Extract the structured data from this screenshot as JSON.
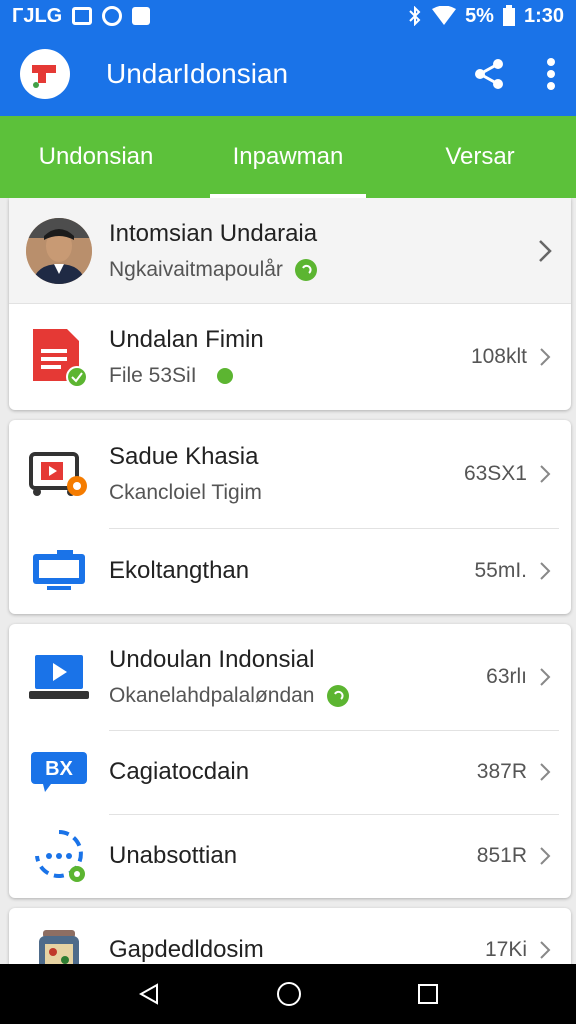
{
  "status": {
    "carrier": "ГJLG",
    "battery": "5%",
    "time": "1:30"
  },
  "app": {
    "title": "UndarIdonsian"
  },
  "tabs": [
    {
      "label": "Undonsian",
      "active": false
    },
    {
      "label": "Inpawman",
      "active": true
    },
    {
      "label": "Versar",
      "active": false
    }
  ],
  "profile": {
    "name": "Intomsian Undaraia",
    "subtitle": "Ngkaivaitmapoulår"
  },
  "cards": [
    {
      "items": [
        {
          "title": "Undalan Fimin",
          "subtitle": "File 53SiI",
          "size": "108klt",
          "icon": "document-icon"
        }
      ]
    },
    {
      "items": [
        {
          "title": "Sadue Khasia",
          "subtitle": "Ckancloiel Tigim",
          "size": "63SX1",
          "icon": "video-file-icon"
        },
        {
          "title": "Ekoltangthan",
          "subtitle": "",
          "size": "55mI.",
          "icon": "monitor-icon"
        }
      ]
    },
    {
      "items": [
        {
          "title": "Undoulan Indonsial",
          "subtitle": "Okanelahdpalaløndan",
          "size": "63rlı",
          "icon": "laptop-play-icon"
        },
        {
          "title": "Cagiatocdain",
          "subtitle": "",
          "size": "387R",
          "icon": "bx-chat-icon"
        },
        {
          "title": "Unabsottian",
          "subtitle": "",
          "size": "851R",
          "icon": "sync-chat-icon"
        }
      ]
    },
    {
      "items": [
        {
          "title": "Gapdedldosim",
          "subtitle": "",
          "size": "17Ki",
          "icon": "jar-icon"
        }
      ]
    }
  ],
  "colors": {
    "appbar": "#1a73e8",
    "tabbar": "#5cc13a",
    "accent_green": "#5cb531"
  }
}
